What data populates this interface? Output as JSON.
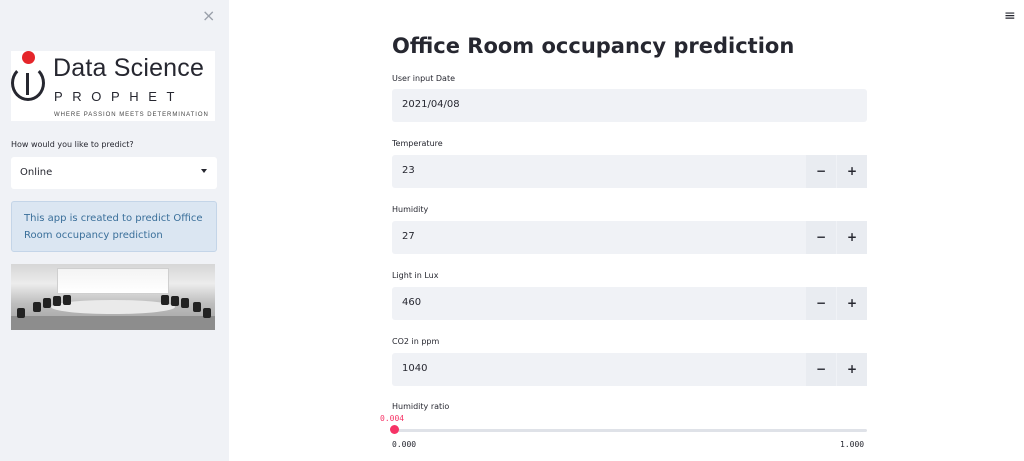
{
  "sidebar": {
    "close_icon": "×",
    "logo": {
      "line1": "Data Science",
      "line2": "PROPHET",
      "tagline": "WHERE PASSION MEETS DETERMINATION"
    },
    "predict_label": "How would you like to predict?",
    "predict_select": {
      "value": "Online",
      "options": [
        "Online"
      ]
    },
    "info_text": "This app is created to predict Office Room occupancy prediction",
    "image_alt": "conference-room-image"
  },
  "main": {
    "title": "Office Room occupancy prediction",
    "date": {
      "label": "User input Date",
      "value": "2021/04/08"
    },
    "temperature": {
      "label": "Temperature",
      "value": "23",
      "minus": "−",
      "plus": "+"
    },
    "humidity": {
      "label": "Humidity",
      "value": "27",
      "minus": "−",
      "plus": "+"
    },
    "light": {
      "label": "Light in Lux",
      "value": "460",
      "minus": "−",
      "plus": "+"
    },
    "co2": {
      "label": "CO2 in ppm",
      "value": "1040",
      "minus": "−",
      "plus": "+"
    },
    "humidity_ratio": {
      "label": "Humidity ratio",
      "value": "0.004",
      "min": "0.000",
      "max": "1.000"
    }
  },
  "menu_icon": "≡",
  "colors": {
    "accent": "#f63366",
    "sidebar_bg": "#f0f2f6",
    "info_bg": "#dbe6f2",
    "info_text": "#3a6f9a"
  }
}
